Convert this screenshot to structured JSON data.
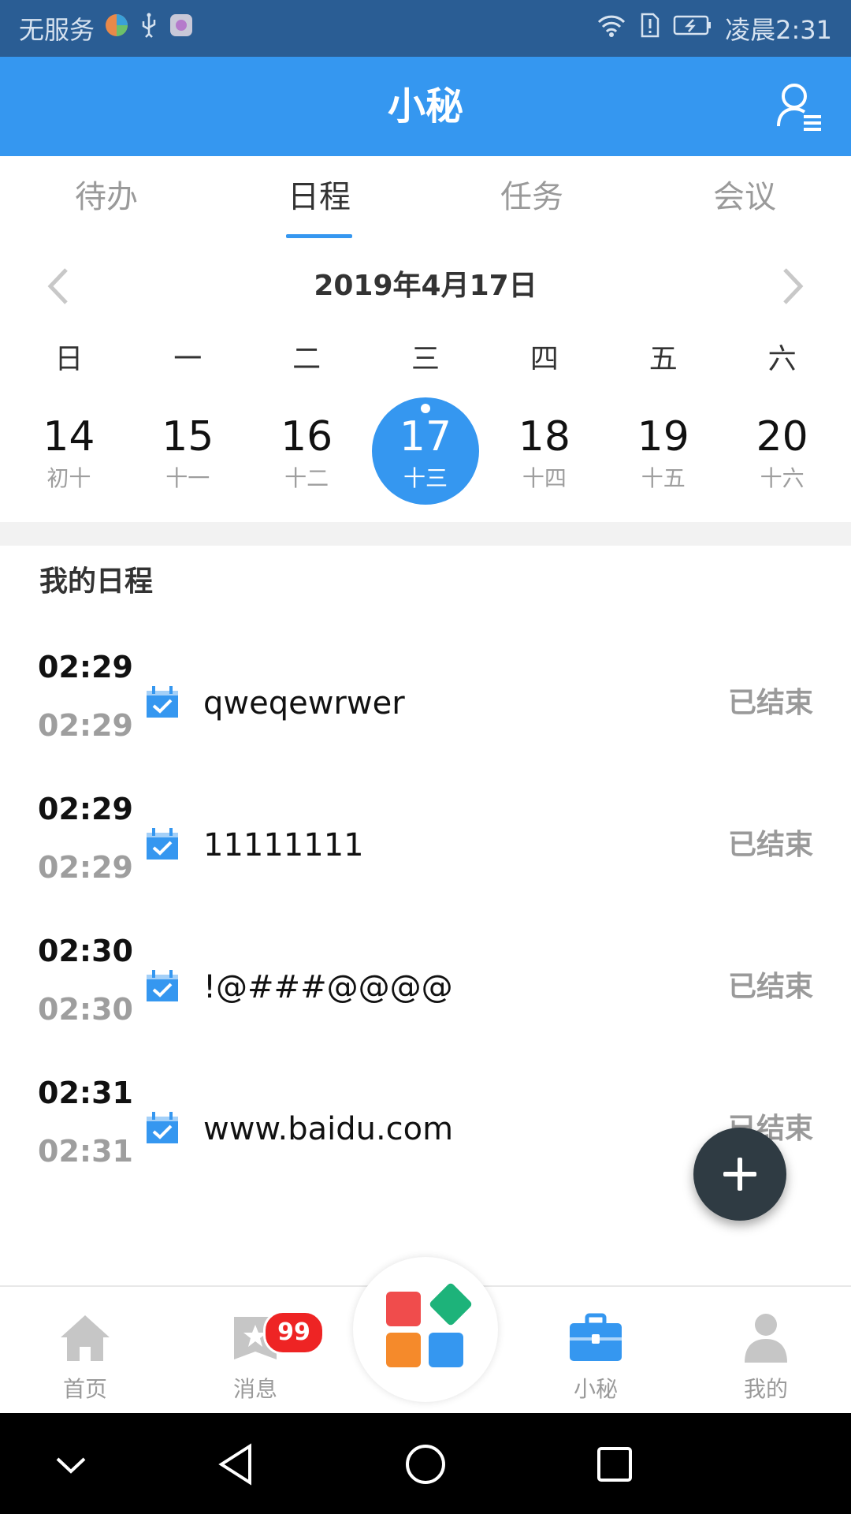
{
  "status_bar": {
    "carrier": "无服务",
    "time": "凌晨2:31"
  },
  "app_bar": {
    "title": "小秘",
    "menu_icon": "user-menu-icon"
  },
  "tabs": [
    {
      "label": "待办",
      "active": false
    },
    {
      "label": "日程",
      "active": true
    },
    {
      "label": "任务",
      "active": false
    },
    {
      "label": "会议",
      "active": false
    }
  ],
  "calendar": {
    "month_title": "2019年4月17日",
    "weekdays": [
      "日",
      "一",
      "二",
      "三",
      "四",
      "五",
      "六"
    ],
    "days": [
      {
        "num": "14",
        "lunar": "初十",
        "selected": false
      },
      {
        "num": "15",
        "lunar": "十一",
        "selected": false
      },
      {
        "num": "16",
        "lunar": "十二",
        "selected": false
      },
      {
        "num": "17",
        "lunar": "十三",
        "selected": true
      },
      {
        "num": "18",
        "lunar": "十四",
        "selected": false
      },
      {
        "num": "19",
        "lunar": "十五",
        "selected": false
      },
      {
        "num": "20",
        "lunar": "十六",
        "selected": false
      }
    ]
  },
  "schedule": {
    "section_title": "我的日程",
    "items": [
      {
        "start": "02:29",
        "end": "02:29",
        "title": "qweqewrwer",
        "status": "已结束"
      },
      {
        "start": "02:29",
        "end": "02:29",
        "title": "11111111",
        "status": "已结束"
      },
      {
        "start": "02:30",
        "end": "02:30",
        "title": "!@###@@@@",
        "status": "已结束"
      },
      {
        "start": "02:31",
        "end": "02:31",
        "title": "www.baidu.com",
        "status": "已结束"
      }
    ]
  },
  "bottom_nav": {
    "items": [
      {
        "label": "首页",
        "icon": "home-icon",
        "active": false
      },
      {
        "label": "消息",
        "icon": "message-icon",
        "active": false,
        "badge": "99"
      },
      {
        "label": "小秘",
        "icon": "briefcase-icon",
        "active": true
      },
      {
        "label": "我的",
        "icon": "profile-icon",
        "active": false
      }
    ]
  },
  "colors": {
    "primary": "#3597f0",
    "status_bar": "#2a5d94",
    "fab": "#2f3b43",
    "badge": "#ee2424"
  }
}
